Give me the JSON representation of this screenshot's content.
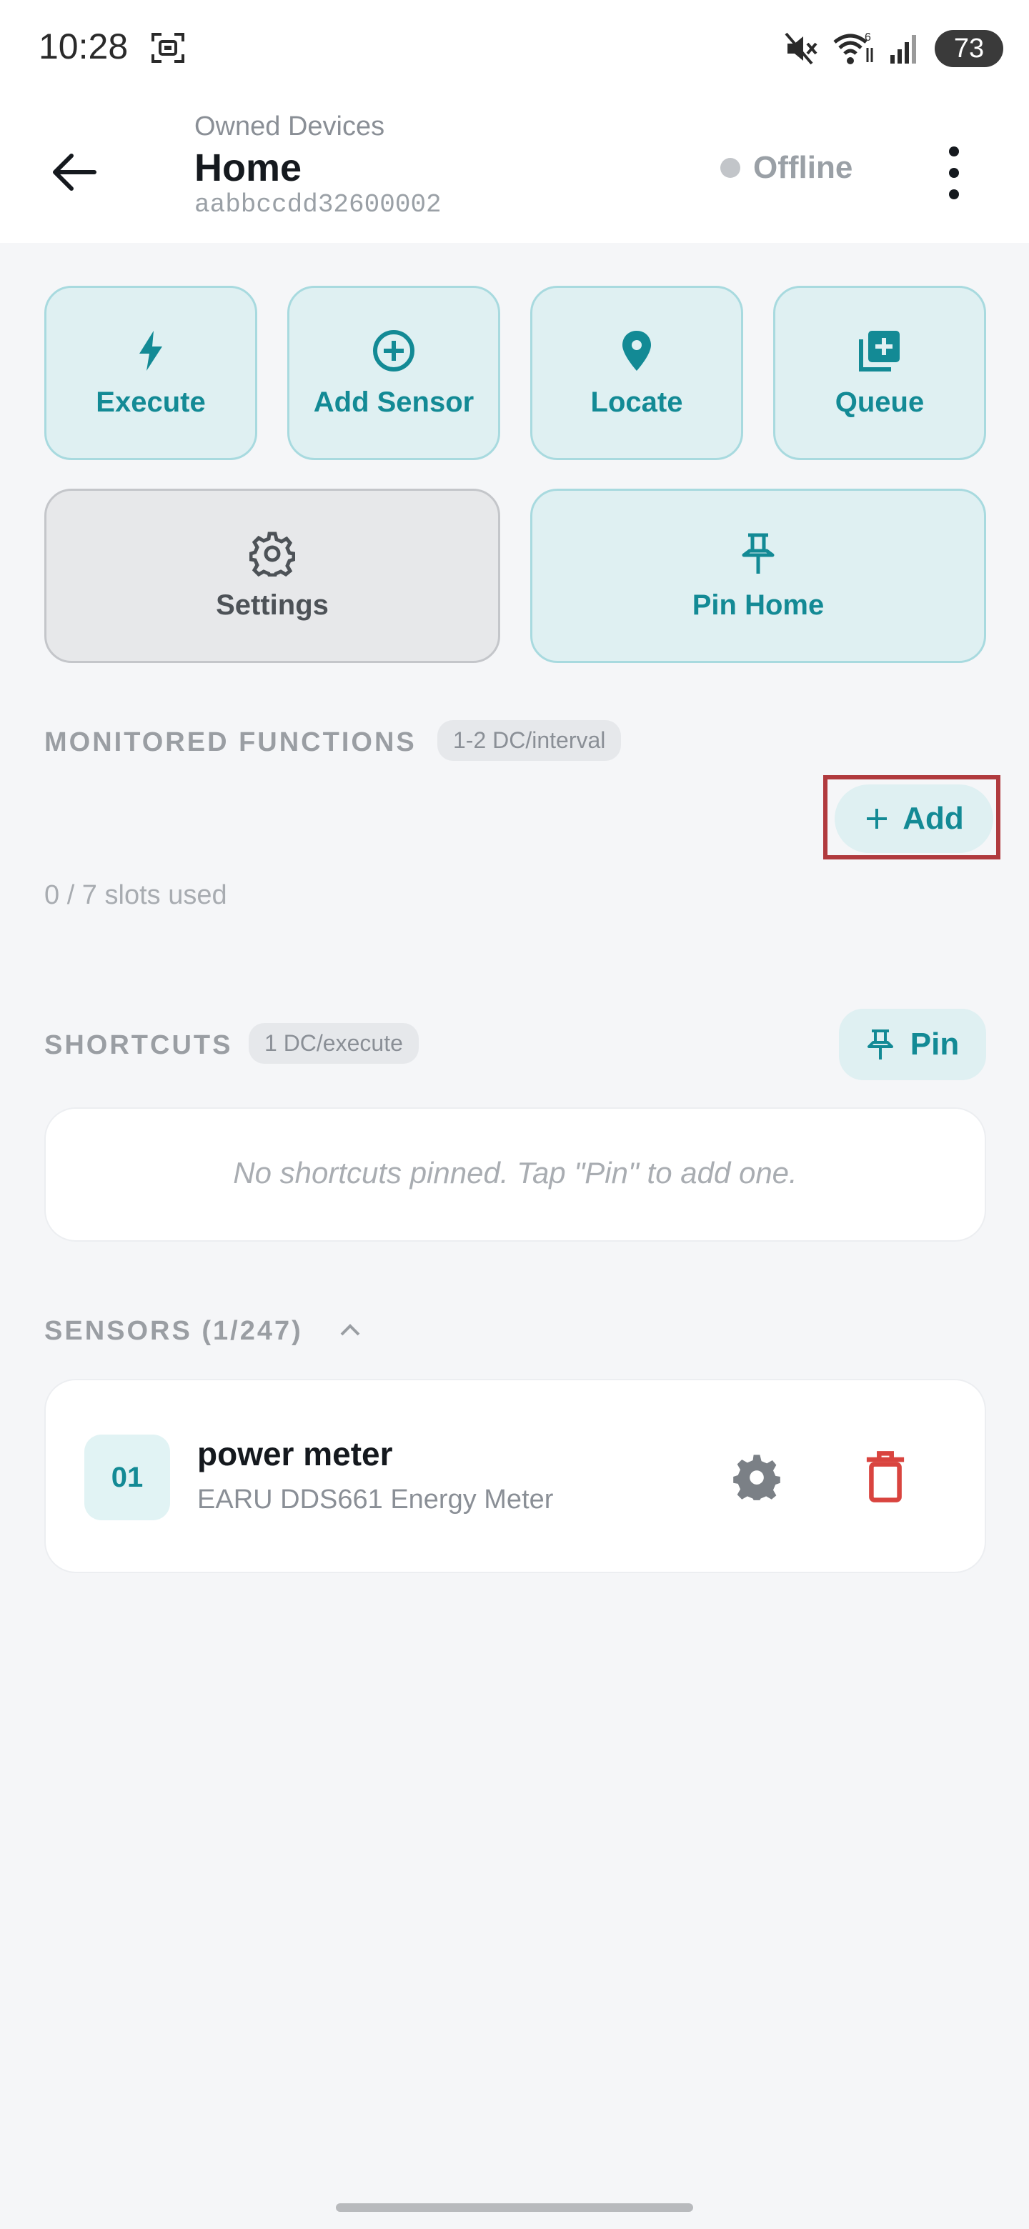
{
  "status_bar": {
    "time": "10:28",
    "battery": "73",
    "signal_badge": "6",
    "icons": [
      "screenshot-icon",
      "mute-icon",
      "wifi-icon",
      "signal-icon",
      "battery-icon"
    ]
  },
  "header": {
    "breadcrumb": "Owned Devices",
    "title": "Home",
    "device_id": "aabbccdd32600002",
    "status": "Offline"
  },
  "actions": [
    {
      "label": "Execute",
      "icon": "bolt-icon"
    },
    {
      "label": "Add Sensor",
      "icon": "add-circle-icon"
    },
    {
      "label": "Locate",
      "icon": "location-pin-icon"
    },
    {
      "label": "Queue",
      "icon": "queue-add-icon"
    },
    {
      "label": "Settings",
      "icon": "gear-icon"
    },
    {
      "label": "Pin Home",
      "icon": "pushpin-icon"
    }
  ],
  "monitored": {
    "label": "MONITORED FUNCTIONS",
    "cost": "1-2 DC/interval",
    "add_label": "Add",
    "slots": "0 / 7 slots used"
  },
  "shortcuts": {
    "label": "SHORTCUTS",
    "cost": "1 DC/execute",
    "pin_label": "Pin",
    "empty": "No shortcuts pinned. Tap \"Pin\" to add one."
  },
  "sensors": {
    "label": "SENSORS (1/247)",
    "items": [
      {
        "num": "01",
        "name": "power meter",
        "model": "EARU DDS661 Energy Meter"
      }
    ]
  },
  "colors": {
    "accent": "#138a95",
    "accent_bg": "#dff0f2",
    "delete": "#d9443f",
    "highlight": "#b03a3e"
  }
}
